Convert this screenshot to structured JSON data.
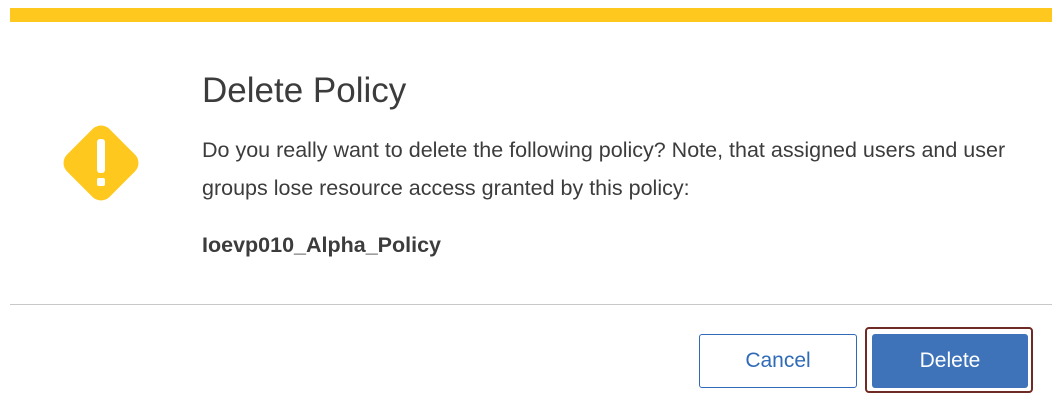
{
  "dialog": {
    "title": "Delete Policy",
    "message": "Do you really want to delete the following policy? Note, that assigned users and user groups lose resource access granted by this policy:",
    "policy_name": "Ioevp010_Alpha_Policy",
    "icon": "warning-icon",
    "buttons": {
      "cancel_label": "Cancel",
      "delete_label": "Delete"
    }
  },
  "colors": {
    "accent_bar": "#ffc81e",
    "warning_icon": "#ffc81e",
    "primary_button": "#3e73b9",
    "secondary_button_border": "#2f6bb6",
    "focus_outline": "#6e2a25",
    "text": "#3c3c3c"
  }
}
